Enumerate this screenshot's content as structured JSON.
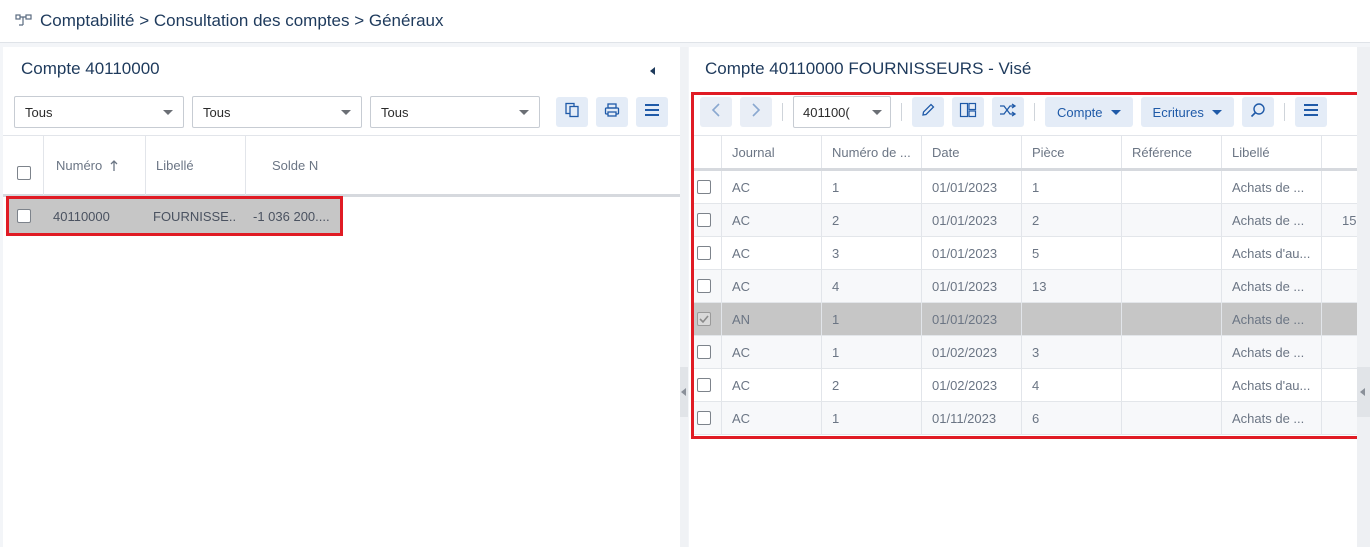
{
  "breadcrumb": {
    "icon": "hierarchy-icon",
    "text": "Comptabilité > Consultation des comptes > Généraux"
  },
  "left_panel": {
    "title": "Compte 40110000",
    "filters": [
      "Tous",
      "Tous",
      "Tous"
    ],
    "toolbar_icons": [
      "copy-icon",
      "print-icon",
      "menu-icon"
    ],
    "columns": [
      "Numéro",
      "Libellé",
      "Solde N"
    ],
    "sort_column": "Numéro",
    "rows": [
      {
        "numero": "40110000",
        "libelle": "FOURNISSE...",
        "solde": "-1 036 200...."
      }
    ]
  },
  "right_panel": {
    "title": "Compte 40110000 FOURNISSEURS - Visé",
    "account_select": "401100(",
    "buttons": {
      "compte": "Compte",
      "ecritures": "Ecritures"
    },
    "toolbar_icons": [
      "chevron-left-icon",
      "chevron-right-icon",
      "pencil-icon",
      "split-icon",
      "shuffle-icon",
      "search-icon",
      "menu-icon"
    ],
    "columns": [
      "Journal",
      "Numéro de ...",
      "Date",
      "Pièce",
      "Référence",
      "Libellé"
    ],
    "rows": [
      {
        "journal": "AC",
        "numero": "1",
        "date": "01/01/2023",
        "piece": "1",
        "reference": "",
        "libelle": "Achats de ...",
        "extra": "",
        "checked": false
      },
      {
        "journal": "AC",
        "numero": "2",
        "date": "01/01/2023",
        "piece": "2",
        "reference": "",
        "libelle": "Achats de ...",
        "extra": "15",
        "checked": false
      },
      {
        "journal": "AC",
        "numero": "3",
        "date": "01/01/2023",
        "piece": "5",
        "reference": "",
        "libelle": "Achats d'au...",
        "extra": "",
        "checked": false
      },
      {
        "journal": "AC",
        "numero": "4",
        "date": "01/01/2023",
        "piece": "13",
        "reference": "",
        "libelle": "Achats de ...",
        "extra": "",
        "checked": false
      },
      {
        "journal": "AN",
        "numero": "1",
        "date": "01/01/2023",
        "piece": "",
        "reference": "",
        "libelle": "Achats de ...",
        "extra": "",
        "checked": true
      },
      {
        "journal": "AC",
        "numero": "1",
        "date": "01/02/2023",
        "piece": "3",
        "reference": "",
        "libelle": "Achats de ...",
        "extra": "",
        "checked": false
      },
      {
        "journal": "AC",
        "numero": "2",
        "date": "01/02/2023",
        "piece": "4",
        "reference": "",
        "libelle": "Achats d'au...",
        "extra": "",
        "checked": false
      },
      {
        "journal": "AC",
        "numero": "1",
        "date": "01/11/2023",
        "piece": "6",
        "reference": "",
        "libelle": "Achats de ...",
        "extra": "",
        "checked": false
      }
    ]
  },
  "colors": {
    "accent": "#1f5aa8",
    "title": "#1e3a5c",
    "highlight_border": "#e01b24",
    "selected_row": "#c6c6c6"
  }
}
